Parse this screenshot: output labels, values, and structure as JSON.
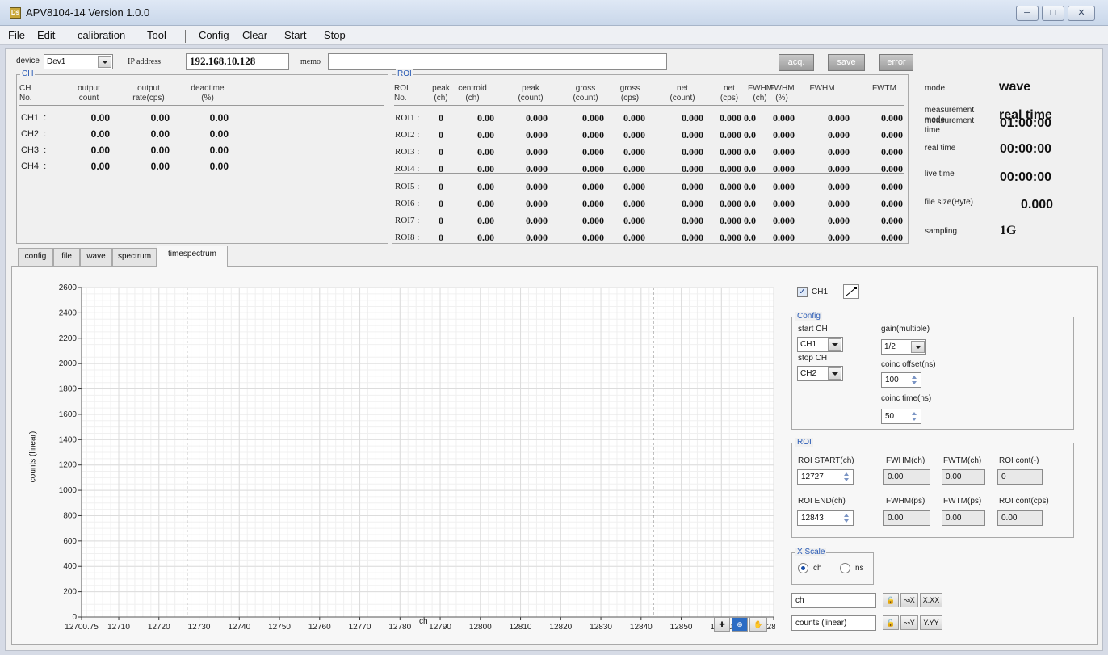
{
  "window": {
    "title": "APV8104-14   Version 1.0.0",
    "app_icon": "Ds"
  },
  "menu": [
    "File",
    "Edit",
    "calibration",
    "Tool",
    "Config",
    "Clear",
    "Start",
    "Stop"
  ],
  "top": {
    "device_label": "device",
    "device_value": "Dev1",
    "ip_label": "IP address",
    "ip_value": "192.168.10.128",
    "memo_label": "memo",
    "memo_value": "",
    "buttons": {
      "acq": "acq.",
      "save": "save",
      "error": "error"
    }
  },
  "ch_panel": {
    "title": "CH",
    "headers": [
      "CH\nNo.",
      "output\ncount",
      "output\nrate(cps)",
      "deadtime\n(%)"
    ],
    "rows": [
      {
        "label": "CH1  :",
        "values": [
          "0.00",
          "0.00",
          "0.00"
        ]
      },
      {
        "label": "CH2  :",
        "values": [
          "0.00",
          "0.00",
          "0.00"
        ]
      },
      {
        "label": "CH3  :",
        "values": [
          "0.00",
          "0.00",
          "0.00"
        ]
      },
      {
        "label": "CH4  :",
        "values": [
          "0.00",
          "0.00",
          "0.00"
        ]
      }
    ]
  },
  "roi_panel": {
    "title": "ROI",
    "headers": [
      "ROI\nNo.",
      "peak\n(ch)",
      "centroid\n(ch)",
      "peak\n(count)",
      "gross\n(count)",
      "gross\n(cps)",
      "net\n(count)",
      "net\n(cps)",
      "FWHM\n(ch)",
      "FWHM\n(%)",
      "FWHM",
      "FWTM"
    ],
    "rows": [
      {
        "label": "ROI1 :",
        "values": [
          "0",
          "0.00",
          "0.000",
          "0.000",
          "0.000",
          "0.000",
          "0.000",
          "0.0",
          "0.000",
          "0.000",
          "0.000"
        ]
      },
      {
        "label": "ROI2 :",
        "values": [
          "0",
          "0.00",
          "0.000",
          "0.000",
          "0.000",
          "0.000",
          "0.000",
          "0.0",
          "0.000",
          "0.000",
          "0.000"
        ]
      },
      {
        "label": "ROI3 :",
        "values": [
          "0",
          "0.00",
          "0.000",
          "0.000",
          "0.000",
          "0.000",
          "0.000",
          "0.0",
          "0.000",
          "0.000",
          "0.000"
        ]
      },
      {
        "label": "ROI4 :",
        "values": [
          "0",
          "0.00",
          "0.000",
          "0.000",
          "0.000",
          "0.000",
          "0.000",
          "0.0",
          "0.000",
          "0.000",
          "0.000"
        ]
      },
      {
        "label": "ROI5 :",
        "values": [
          "0",
          "0.00",
          "0.000",
          "0.000",
          "0.000",
          "0.000",
          "0.000",
          "0.0",
          "0.000",
          "0.000",
          "0.000"
        ]
      },
      {
        "label": "ROI6 :",
        "values": [
          "0",
          "0.00",
          "0.000",
          "0.000",
          "0.000",
          "0.000",
          "0.000",
          "0.0",
          "0.000",
          "0.000",
          "0.000"
        ]
      },
      {
        "label": "ROI7 :",
        "values": [
          "0",
          "0.00",
          "0.000",
          "0.000",
          "0.000",
          "0.000",
          "0.000",
          "0.0",
          "0.000",
          "0.000",
          "0.000"
        ]
      },
      {
        "label": "ROI8 :",
        "values": [
          "0",
          "0.00",
          "0.000",
          "0.000",
          "0.000",
          "0.000",
          "0.000",
          "0.0",
          "0.000",
          "0.000",
          "0.000"
        ]
      }
    ]
  },
  "status": {
    "mode_label": "mode",
    "mode_value": "wave",
    "meas_mode_label": "measurement\nmode",
    "meas_mode_value": "real time",
    "meas_time_label": "measurement\ntime",
    "meas_time_value": "01:00:00",
    "real_time_label": "real time",
    "real_time_value": "00:00:00",
    "live_time_label": "live time",
    "live_time_value": "00:00:00",
    "file_size_label": "file size(Byte)",
    "file_size_value": "0.000",
    "sampling_label": "sampling",
    "sampling_value": "1G"
  },
  "tabs": [
    "config",
    "file",
    "wave",
    "spectrum",
    "timespectrum"
  ],
  "active_tab": "timespectrum",
  "chart_data": {
    "type": "line",
    "xlabel": "ch",
    "ylabel": "counts (linear)",
    "xlim": [
      12700.75,
      12873
    ],
    "ylim": [
      0,
      2600
    ],
    "xticks": [
      "12700.75",
      "12710",
      "12720",
      "12730",
      "12740",
      "12750",
      "12760",
      "12770",
      "12780",
      "12790",
      "12800",
      "12810",
      "12820",
      "12830",
      "12840",
      "12850",
      "12860",
      "12873"
    ],
    "yticks": [
      "0",
      "200",
      "400",
      "600",
      "800",
      "1000",
      "1200",
      "1400",
      "1600",
      "1800",
      "2000",
      "2200",
      "2400",
      "2600"
    ],
    "roi_markers": [
      12727,
      12843
    ],
    "series": [],
    "grid": true
  },
  "right_panel": {
    "ch1_label": "CH1",
    "config_title": "Config",
    "start_ch_label": "start CH",
    "start_ch_value": "CH1",
    "stop_ch_label": "stop CH",
    "stop_ch_value": "CH2",
    "gain_label": "gain(multiple)",
    "gain_value": "1/2",
    "coinc_offset_label": "coinc offset(ns)",
    "coinc_offset_value": "100",
    "coinc_time_label": "coinc time(ns)",
    "coinc_time_value": "50",
    "roi_title": "ROI",
    "roi_start_label": "ROI START(ch)",
    "roi_start_value": "12727",
    "roi_end_label": "ROI END(ch)",
    "roi_end_value": "12843",
    "fwhm_ch_label": "FWHM(ch)",
    "fwhm_ch_value": "0.00",
    "fwtm_ch_label": "FWTM(ch)",
    "fwtm_ch_value": "0.00",
    "roi_cont_label": "ROI cont(-)",
    "roi_cont_value": "0",
    "fwhm_ps_label": "FWHM(ps)",
    "fwhm_ps_value": "0.00",
    "fwtm_ps_label": "FWTM(ps)",
    "fwtm_ps_value": "0.00",
    "roi_cont_cps_label": "ROI cont(cps)",
    "roi_cont_cps_value": "0.00",
    "xscale_title": "X Scale",
    "xscale_ch": "ch",
    "xscale_ns": "ns",
    "x_axis_name": "ch",
    "y_axis_name": "counts (linear)",
    "x_fmt": "X.XX",
    "y_fmt": "Y.YY"
  }
}
